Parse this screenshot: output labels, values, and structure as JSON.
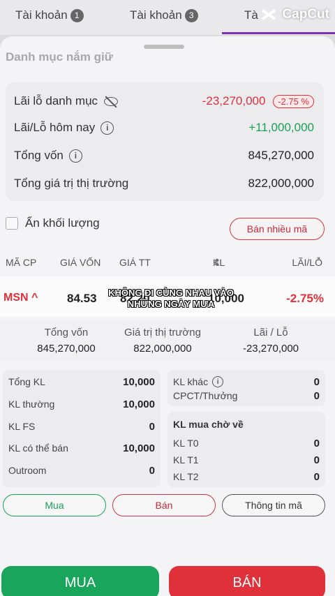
{
  "tabs": [
    {
      "label": "Tài khoản",
      "num": "1"
    },
    {
      "label": "Tài khoản",
      "num": "3"
    },
    {
      "label": "Tà",
      "num": ""
    }
  ],
  "watermark": "CapCut",
  "cut_header": "Danh mục nắm giữ",
  "summary": {
    "portfolio_pl_label": "Lãi lỗ danh mục",
    "portfolio_pl_value": "-23,270,000",
    "portfolio_pl_pct": "-2.75 %",
    "today_pl_label": "Lãi/Lỗ hôm nay",
    "today_pl_value": "+11,000,000",
    "total_capital_label": "Tổng vốn",
    "total_capital_value": "845,270,000",
    "market_value_label": "Tổng giá trị thị trường",
    "market_value_value": "822,000,000"
  },
  "hide_volume_label": "Ẩn khối lượng",
  "sell_many_label": "Bán nhiều mã",
  "columns": {
    "code": "MÃ CP",
    "cost": "GIÁ VỐN",
    "price": "GIÁ TT",
    "kl": "KL",
    "pl": "LÃI/LỖ"
  },
  "stock": {
    "code": "MSN",
    "cost": "84.53",
    "price": "82.20",
    "kl": "10,000",
    "pl": "-2.75%"
  },
  "caption": "KHÔNG ĐI CÙNG NHAU VÀO NHỮNG NGÀY MƯA",
  "totals": {
    "capital_label": "Tổng vốn",
    "capital_value": "845,270,000",
    "market_label": "Giá trị thị trường",
    "market_value": "822,000,000",
    "pl_label": "Lãi / Lỗ",
    "pl_value": "-23,270,000"
  },
  "details_left": [
    {
      "label": "Tổng KL",
      "value": "10,000"
    },
    {
      "label": "KL thường",
      "value": "10,000"
    },
    {
      "label": "KL FS",
      "value": "0"
    },
    {
      "label": "KL có thể bán",
      "value": "10,000"
    },
    {
      "label": "Outroom",
      "value": "0"
    }
  ],
  "details_right_top": [
    {
      "label": "KL khác",
      "value": "0"
    },
    {
      "label": "CPCT/Thưởng",
      "value": "0"
    }
  ],
  "pending_title": "KL mua chờ về",
  "details_right_pending": [
    {
      "label": "KL T0",
      "value": "0"
    },
    {
      "label": "KL T1",
      "value": "0"
    },
    {
      "label": "KL T2",
      "value": "0"
    }
  ],
  "actions": {
    "buy": "Mua",
    "sell": "Bán",
    "info": "Thông tin mã"
  },
  "big_buttons": {
    "buy": "MUA",
    "sell": "BÁN"
  },
  "colors": {
    "red": "#e0303a",
    "green": "#19a55b",
    "purple": "#7b2fb0"
  }
}
